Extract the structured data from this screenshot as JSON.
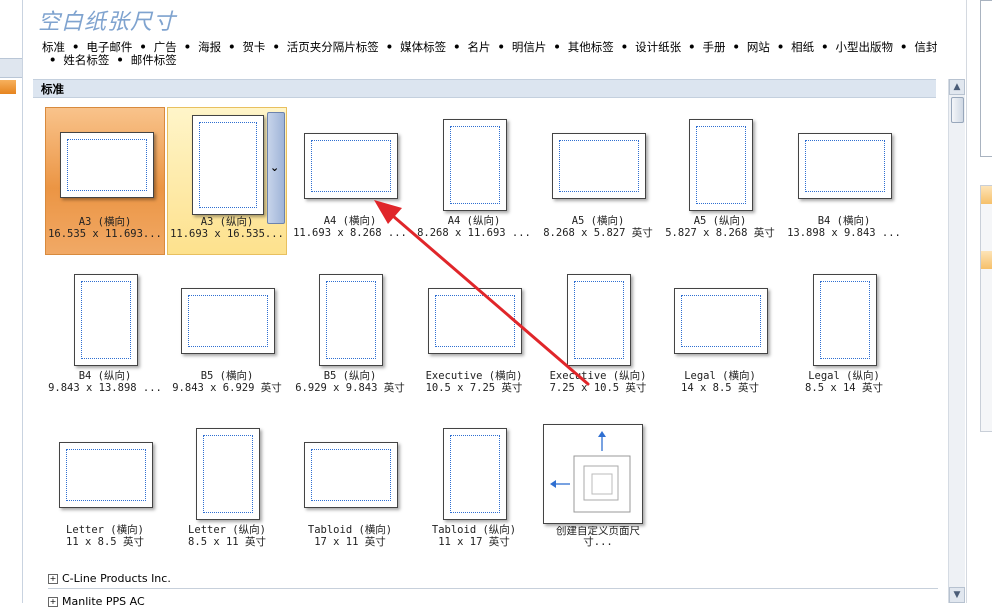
{
  "title": "空白纸张尺寸",
  "categories": [
    "标准",
    "电子邮件",
    "广告",
    "海报",
    "贺卡",
    "活页夹分隔片标签",
    "媒体标签",
    "名片",
    "明信片",
    "其他标签",
    "设计纸张",
    "手册",
    "网站",
    "相纸",
    "小型出版物",
    "信封",
    "姓名标签",
    "邮件标签"
  ],
  "section_label": "标准",
  "tiles": [
    {
      "name": "A3 (横向)",
      "size": "16.535 x 11.693...",
      "orient": "landscape"
    },
    {
      "name": "A3 (纵向)",
      "size": "11.693 x 16.535...",
      "orient": "portrait"
    },
    {
      "name": "A4 (横向)",
      "size": "11.693 x 8.268 ...",
      "orient": "landscape"
    },
    {
      "name": "A4 (纵向)",
      "size": "8.268 x 11.693 ...",
      "orient": "portrait"
    },
    {
      "name": "A5 (横向)",
      "size": "8.268 x 5.827 英寸",
      "orient": "landscape"
    },
    {
      "name": "A5 (纵向)",
      "size": "5.827 x 8.268 英寸",
      "orient": "portrait"
    },
    {
      "name": "B4 (横向)",
      "size": "13.898 x 9.843 ...",
      "orient": "landscape"
    },
    {
      "name": "B4 (纵向)",
      "size": "9.843 x 13.898 ...",
      "orient": "portrait"
    },
    {
      "name": "B5 (横向)",
      "size": "9.843 x 6.929 英寸",
      "orient": "landscape"
    },
    {
      "name": "B5 (纵向)",
      "size": "6.929 x 9.843 英寸",
      "orient": "portrait"
    },
    {
      "name": "Executive (横向)",
      "size": "10.5 x 7.25 英寸",
      "orient": "landscape"
    },
    {
      "name": "Executive (纵向)",
      "size": "7.25 x 10.5 英寸",
      "orient": "portrait"
    },
    {
      "name": "Legal (横向)",
      "size": "14 x 8.5 英寸",
      "orient": "landscape"
    },
    {
      "name": "Legal (纵向)",
      "size": "8.5 x 14 英寸",
      "orient": "portrait"
    },
    {
      "name": "Letter (横向)",
      "size": "11 x 8.5 英寸",
      "orient": "landscape"
    },
    {
      "name": "Letter (纵向)",
      "size": "8.5 x 11 英寸",
      "orient": "portrait"
    },
    {
      "name": "Tabloid (横向)",
      "size": "17 x 11 英寸",
      "orient": "landscape"
    },
    {
      "name": "Tabloid (纵向)",
      "size": "11 x 17 英寸",
      "orient": "portrait"
    }
  ],
  "custom_tile": {
    "line1": "创建自定义页面尺",
    "line2": "寸..."
  },
  "groups": [
    "C-Line Products Inc.",
    "Manlite PPS AC"
  ],
  "colors": {
    "accent_blue": "#2f6fd1",
    "arrow_red": "#e0262a",
    "selected_orange": "#eb9544",
    "hover_yellow": "#fde18d"
  }
}
